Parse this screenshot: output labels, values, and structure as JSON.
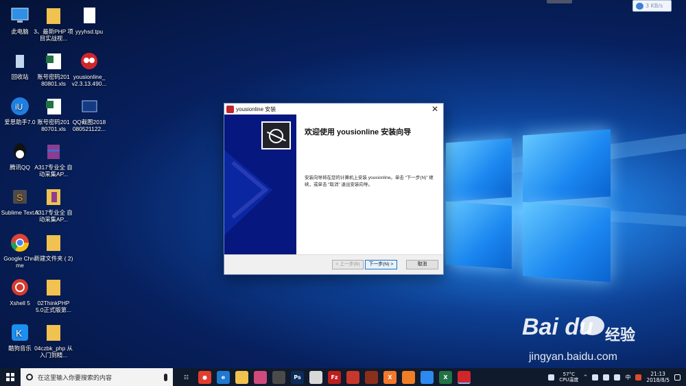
{
  "desktop_icons": [
    {
      "label": "此电脑",
      "icon": "computer-icon"
    },
    {
      "label": "3、最新PHP 项目实战视...",
      "icon": "folder-icon"
    },
    {
      "label": "yyyhsd.tpu",
      "icon": "file-icon"
    },
    {
      "label": "回收站",
      "icon": "recycle-bin-icon"
    },
    {
      "label": "账号密码201 80801.xls",
      "icon": "excel-icon"
    },
    {
      "label": "yousionline_ v2.3.13.490...",
      "icon": "yousionline-icon"
    },
    {
      "label": "爱思助手7.0",
      "icon": "i4-icon"
    },
    {
      "label": "账号密码201 80701.xls",
      "icon": "excel-icon"
    },
    {
      "label": "QQ截图2018 080521122...",
      "icon": "image-icon"
    },
    {
      "label": "腾讯QQ",
      "icon": "qq-icon"
    },
    {
      "label": "A317专业全 自动采集AP...",
      "icon": "winrar-icon"
    },
    {
      "label": "Sublime Text 3",
      "icon": "sublime-icon"
    },
    {
      "label": "A317专业全 自动采集AP...",
      "icon": "zip-folder-icon"
    },
    {
      "label": "Google Chro me",
      "icon": "chrome-icon"
    },
    {
      "label": "新建文件夹 ( 2)",
      "icon": "folder-icon"
    },
    {
      "label": "Xshell 5",
      "icon": "xshell-icon"
    },
    {
      "label": "02ThinkPHP 5.0正式版第...",
      "icon": "folder-icon"
    },
    {
      "label": "酷狗音乐",
      "icon": "kugou-icon"
    },
    {
      "label": "04czbk_php 从入门到精...",
      "icon": "folder-icon"
    }
  ],
  "net_widget": {
    "speed": "3 KB/s"
  },
  "dialog": {
    "title": "yousionline 安装",
    "heading": "欢迎使用 yousionline 安装向导",
    "body": "安装向导将在您的计算机上安装 yousionline。单击 “下一步(N)” 继续，或单击 “取消” 退出安装向导。",
    "buttons": {
      "back": "< 上一步(B)",
      "next": "下一步(N) >",
      "cancel": "取消"
    }
  },
  "watermark": {
    "logo": "Bai du",
    "brand": "经验",
    "url": "jingyan.baidu.com"
  },
  "taskbar": {
    "search_placeholder": "在这里输入你要搜索的内容",
    "apps": [
      {
        "name": "task-view-icon",
        "color": "#0f1a2d",
        "text": "☷"
      },
      {
        "name": "chrome-icon",
        "color": "#e23d2f",
        "text": "●"
      },
      {
        "name": "edge-icon",
        "color": "#1f78d1",
        "text": "e"
      },
      {
        "name": "explorer-icon",
        "color": "#f1c24f",
        "text": ""
      },
      {
        "name": "paint-icon",
        "color": "#d04b7c",
        "text": ""
      },
      {
        "name": "pictures-icon",
        "color": "#4a4a4a",
        "text": ""
      },
      {
        "name": "photoshop-icon",
        "color": "#0b2b59",
        "text": "Ps"
      },
      {
        "name": "task-icon",
        "color": "#d8d8d8",
        "text": ""
      },
      {
        "name": "filezilla-icon",
        "color": "#bf1d1d",
        "text": "Fz"
      },
      {
        "name": "xshell-icon",
        "color": "#c8372b",
        "text": ""
      },
      {
        "name": "sublime-icon",
        "color": "#8b2f1d",
        "text": ""
      },
      {
        "name": "xampp-icon",
        "color": "#f6782c",
        "text": "X"
      },
      {
        "name": "firefox-icon",
        "color": "#f07e26",
        "text": ""
      },
      {
        "name": "baidu-netdisk-icon",
        "color": "#2d88f0",
        "text": ""
      },
      {
        "name": "excel-icon",
        "color": "#217346",
        "text": "X"
      },
      {
        "name": "yousionline-icon",
        "color": "#d0262b",
        "text": ""
      }
    ],
    "tray": {
      "temp": "57°C",
      "temp_label": "CPU温度",
      "lang": "中",
      "time": "21:13",
      "date": "2018/8/5"
    }
  }
}
